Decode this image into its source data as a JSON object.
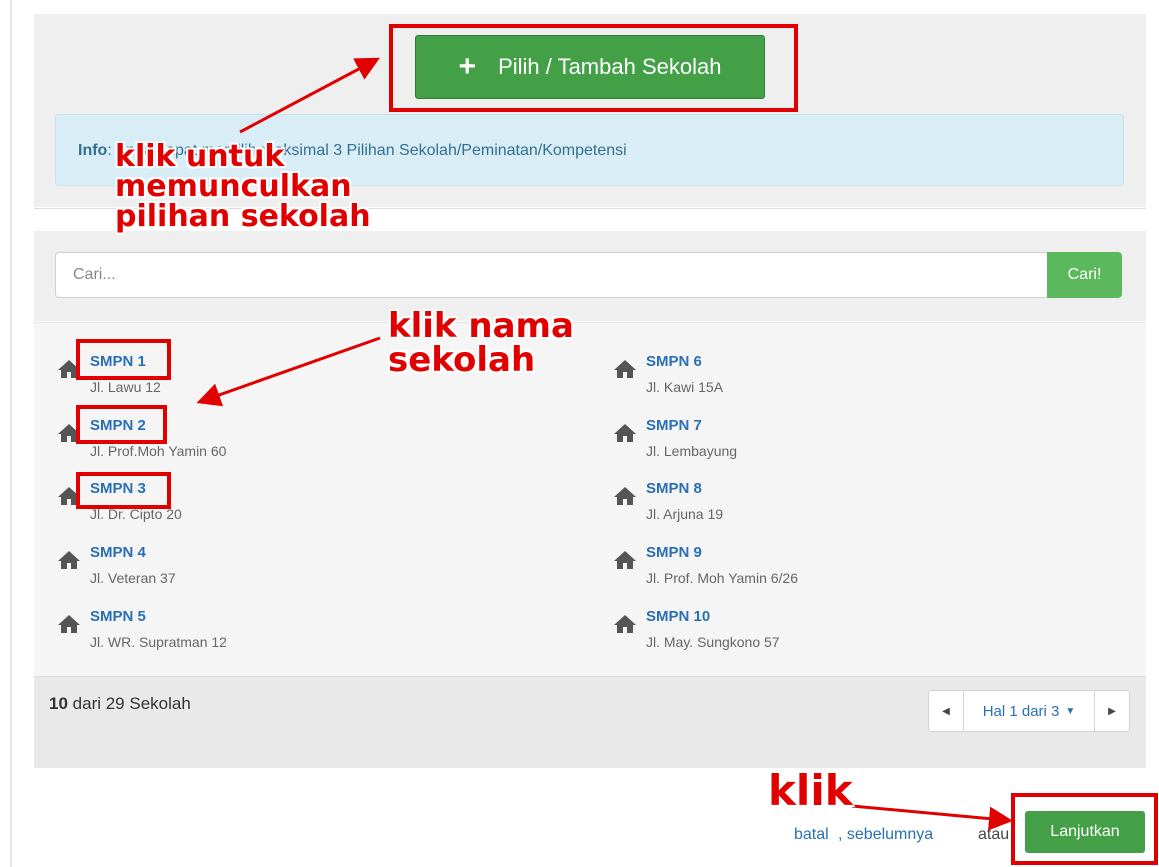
{
  "header": {
    "add_button_icon": "plus-icon",
    "add_button_label": "Pilih / Tambah Sekolah",
    "info_label": "Info",
    "info_text": "Anda dapat memilih maksimal 3 Pilihan Sekolah/Peminatan/Kompetensi"
  },
  "search": {
    "placeholder": "Cari...",
    "button_label": "Cari!"
  },
  "schools": [
    {
      "name": "SMPN 1",
      "address": "Jl. Lawu 12"
    },
    {
      "name": "SMPN 2",
      "address": "Jl. Prof.Moh Yamin 60"
    },
    {
      "name": "SMPN 3",
      "address": "Jl. Dr. Cipto 20"
    },
    {
      "name": "SMPN 4",
      "address": "Jl. Veteran 37"
    },
    {
      "name": "SMPN 5",
      "address": "Jl. WR. Supratman 12"
    },
    {
      "name": "SMPN 6",
      "address": "Jl. Kawi 15A"
    },
    {
      "name": "SMPN 7",
      "address": "Jl. Lembayung"
    },
    {
      "name": "SMPN 8",
      "address": "Jl. Arjuna 19"
    },
    {
      "name": "SMPN 9",
      "address": "Jl. Prof. Moh Yamin 6/26"
    },
    {
      "name": "SMPN 10",
      "address": "Jl. May. Sungkono 57"
    }
  ],
  "school_icon": "home-icon",
  "pagination": {
    "shown": "10",
    "total_text": "dari 29 Sekolah",
    "page_label": "Hal 1 dari 3",
    "prev_icon": "caret-left-icon",
    "next_icon": "caret-right-icon",
    "dropdown_icon": "caret-down-icon"
  },
  "actions": {
    "cancel_label": "batal",
    "previous_label": ", sebelumnya",
    "or_text": "atau",
    "next_label": "Lanjutkan"
  },
  "annotations": {
    "note_add": [
      "klik untuk",
      "memunculkan",
      "pilihan sekolah"
    ],
    "note_name": [
      "klik nama",
      "sekolah"
    ],
    "note_next": "klik",
    "color": "#e00000"
  },
  "colors": {
    "green": "#43a047",
    "link": "#2a6fb5",
    "info_bg": "#d9edf7"
  }
}
